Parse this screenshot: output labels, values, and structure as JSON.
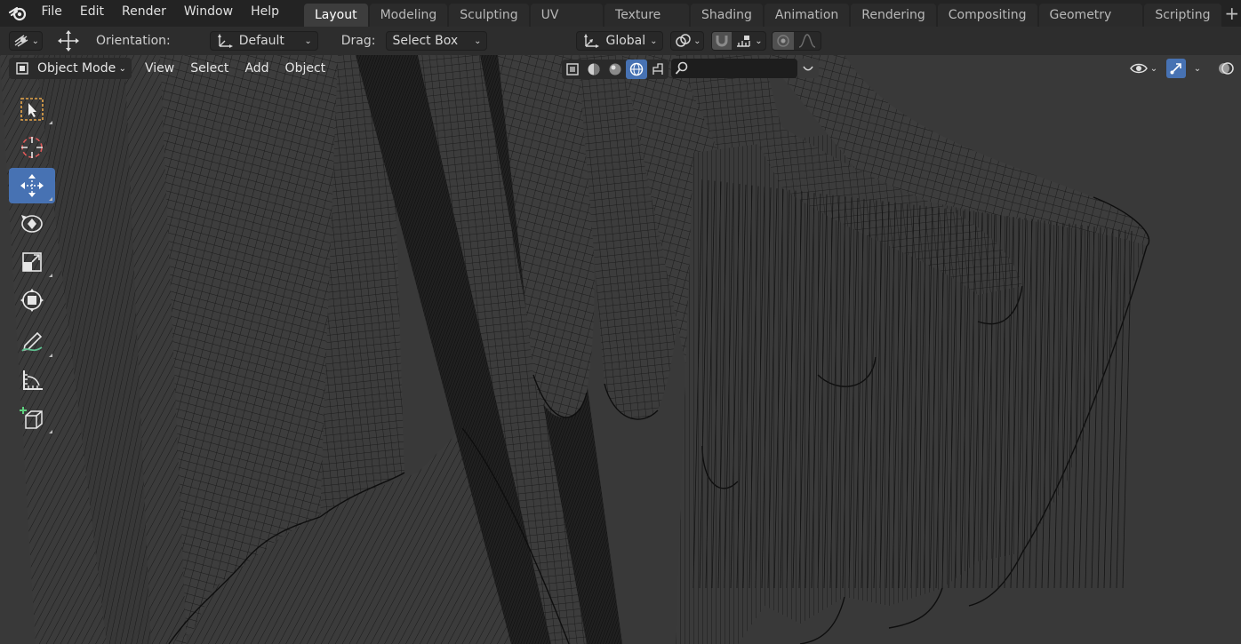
{
  "menu": {
    "items": [
      "File",
      "Edit",
      "Render",
      "Window",
      "Help"
    ]
  },
  "workspaces": {
    "tabs": [
      "Layout",
      "Modeling",
      "Sculpting",
      "UV Editing",
      "Texture Paint",
      "Shading",
      "Animation",
      "Rendering",
      "Compositing",
      "Geometry Nodes",
      "Scripting"
    ],
    "active": "Layout",
    "add_label": "+"
  },
  "tool_header": {
    "orientation_label": "Orientation:",
    "orientation_value": "Default",
    "drag_label": "Drag:",
    "drag_value": "Select Box",
    "transform_orientation": "Global"
  },
  "viewport_header": {
    "mode": "Object Mode",
    "menus": [
      "View",
      "Select",
      "Add",
      "Object"
    ],
    "search_placeholder": "",
    "active_shading": "material-preview"
  },
  "toolbar": {
    "tools": [
      "select-box",
      "cursor",
      "move",
      "rotate",
      "scale",
      "transform",
      "annotate",
      "measure",
      "add-cube"
    ],
    "active": "move"
  },
  "colors": {
    "accent": "#4772b3",
    "topbar": "#232323",
    "header": "#2d2d2d",
    "viewport_bg": "#393939",
    "wire": "#111111"
  }
}
